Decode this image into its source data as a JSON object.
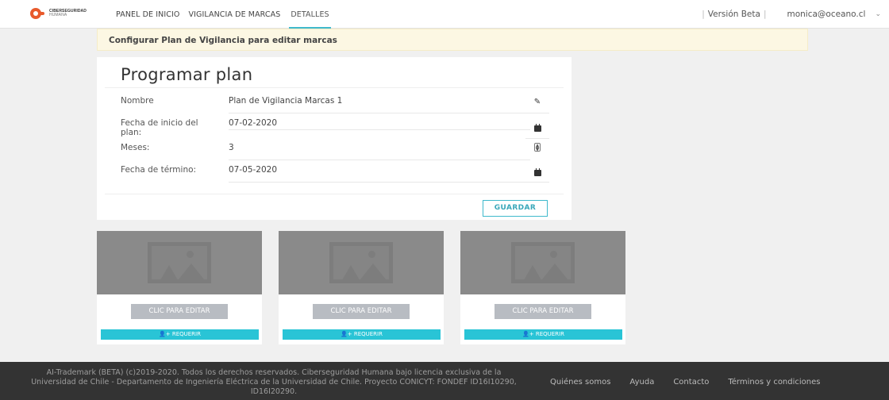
{
  "brand": {
    "line1": "CIBERSEGURIDAD",
    "line2": "HUMANA"
  },
  "nav": {
    "links": [
      "PANEL DE INICIO",
      "VIGILANCIA DE MARCAS",
      "DETALLES"
    ],
    "version": "Versión Beta",
    "user": "monica@oceano.cl"
  },
  "alert": {
    "text": "Configurar Plan de Vigilancia para editar marcas"
  },
  "plan": {
    "title": "Programar plan",
    "fields": [
      {
        "label": "Nombre",
        "value": "Plan de Vigilancia Marcas 1",
        "icon": "edit-icon"
      },
      {
        "label": "Fecha de inicio del plan:",
        "value": "07-02-2020",
        "icon": "calendar-icon"
      },
      {
        "label": "Meses:",
        "value": "3",
        "icon": "spinner-icon"
      },
      {
        "label": "Fecha de término:",
        "value": "07-05-2020",
        "icon": "calendar-icon"
      }
    ],
    "save_label": "GUARDAR"
  },
  "tiles": [
    {
      "edit_label": "CLIC PARA EDITAR",
      "request_label": "REQUERIR"
    },
    {
      "edit_label": "CLIC PARA EDITAR",
      "request_label": "REQUERIR"
    },
    {
      "edit_label": "CLIC PARA EDITAR",
      "request_label": "REQUERIR"
    }
  ],
  "footer": {
    "text": "AI-Trademark (BETA) (c)2019-2020. Todos los derechos reservados. Ciberseguridad Humana bajo licencia exclusiva de la Universidad de Chile - Departamento de Ingeniería Eléctrica de la Universidad de Chile. Proyecto CONICYT: FONDEF ID16I10290, ID16I20290.",
    "links": [
      "Quiénes somos",
      "Ayuda",
      "Contacto",
      "Términos y condiciones"
    ]
  },
  "colors": {
    "accent": "#3fb9cc",
    "request": "#29c4d6",
    "brand": "#e85a2c",
    "alert_bg": "#fcf7e3"
  }
}
